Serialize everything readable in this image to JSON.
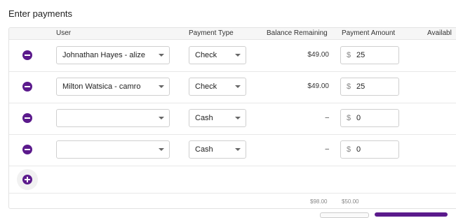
{
  "heading": "Enter payments",
  "columns": {
    "user": "User",
    "payment_type": "Payment Type",
    "balance_remaining": "Balance Remaining",
    "payment_amount": "Payment Amount",
    "available": "Availabl"
  },
  "rows": [
    {
      "user": "Johnathan Hayes - alize",
      "payment_type": "Check",
      "balance": "$49.00",
      "currency": "$",
      "amount": "25"
    },
    {
      "user": "Milton Watsica - camro",
      "payment_type": "Check",
      "balance": "$49.00",
      "currency": "$",
      "amount": "25"
    },
    {
      "user": "",
      "payment_type": "Cash",
      "balance": "–",
      "currency": "$",
      "amount": "0"
    },
    {
      "user": "",
      "payment_type": "Cash",
      "balance": "–",
      "currency": "$",
      "amount": "0"
    }
  ],
  "totals": {
    "balance": "$98.00",
    "amount": "$50.00"
  },
  "colors": {
    "accent": "#5b1a8c"
  },
  "icons": {
    "remove": "minus-circle-icon",
    "add": "plus-circle-icon",
    "dropdown": "chevron-down-icon"
  }
}
